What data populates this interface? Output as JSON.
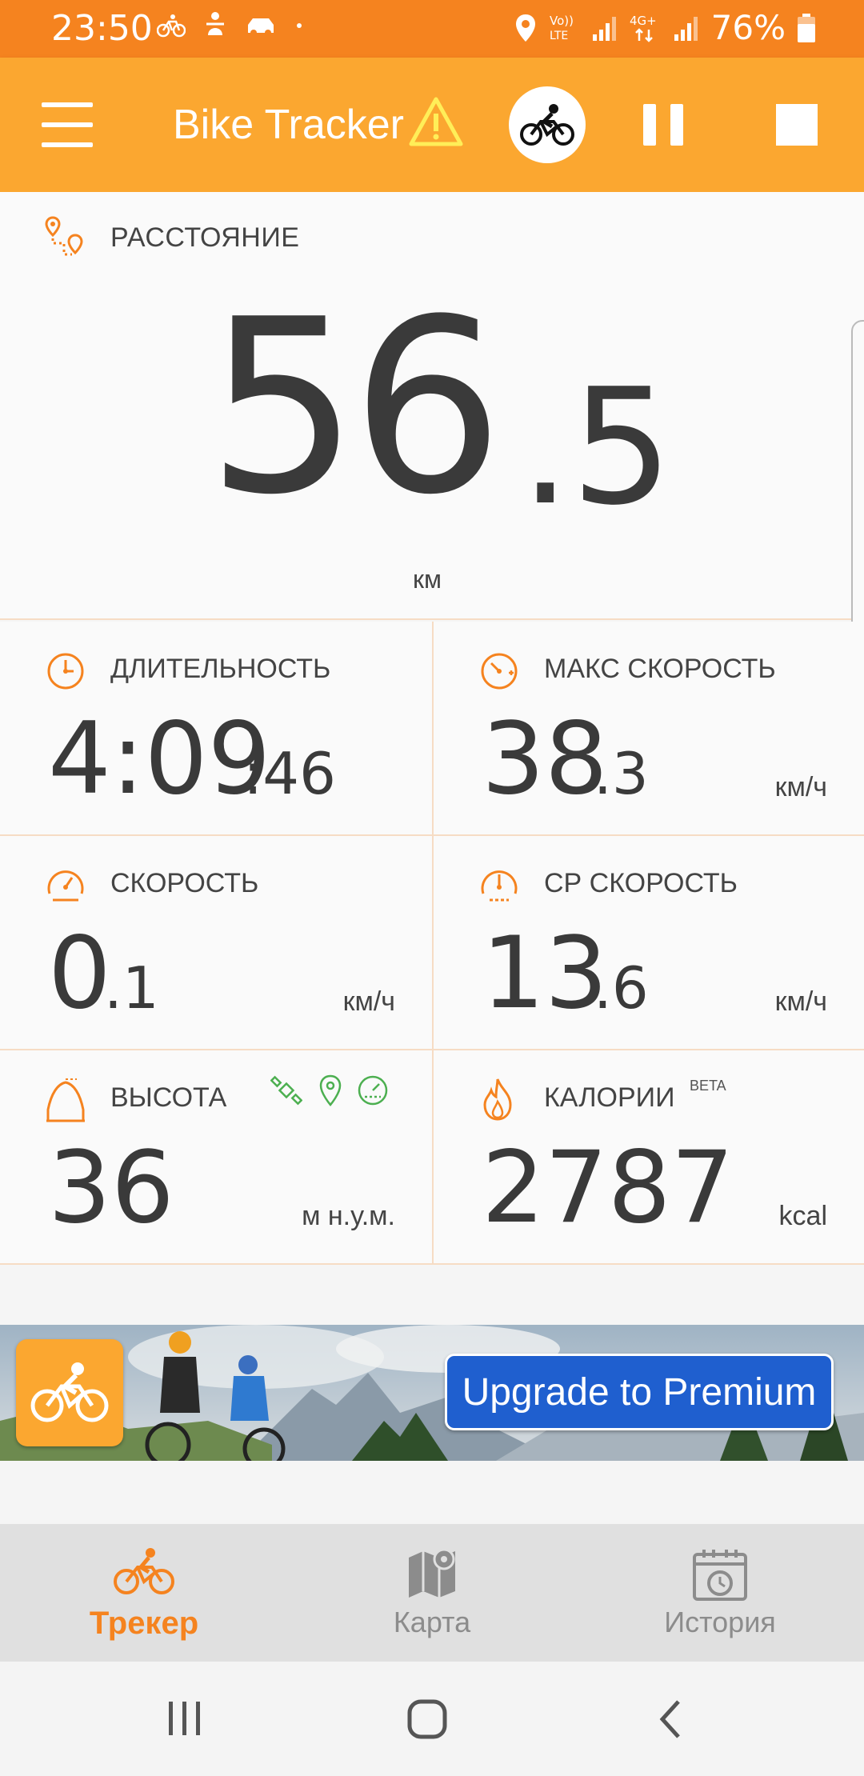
{
  "status_bar": {
    "time": "23:50",
    "battery": "76%",
    "network_label_1": "Vo))\nLTE",
    "network_label_2": "4G+"
  },
  "app_bar": {
    "title": "Bike Tracker",
    "warning_icon": "warning-triangle-icon",
    "activity_icon": "cyclist-icon"
  },
  "distance": {
    "label": "РАССТОЯНИЕ",
    "value_int": "56",
    "value_frac": ".5",
    "unit": "км"
  },
  "stats": {
    "duration": {
      "label": "ДЛИТЕЛЬНОСТЬ",
      "main": "4:09",
      "sub": ":46"
    },
    "max_speed": {
      "label": "МАКС СКОРОСТЬ",
      "main": "38",
      "sub": ".3",
      "unit": "км/ч"
    },
    "speed": {
      "label": "СКОРОСТЬ",
      "main": "0",
      "sub": ".1",
      "unit": "км/ч"
    },
    "avg_speed": {
      "label": "СР СКОРОСТЬ",
      "main": "13",
      "sub": ".6",
      "unit": "км/ч"
    },
    "altitude": {
      "label": "ВЫСОТА",
      "main": "36",
      "unit": "м н.у.м."
    },
    "calories": {
      "label": "КАЛОРИИ",
      "badge": "BETA",
      "main": "2787",
      "unit": "kcal"
    }
  },
  "ad": {
    "button": "Upgrade to Premium"
  },
  "bottom_nav": {
    "items": [
      {
        "label": "Трекер",
        "icon": "cyclist-icon",
        "active": true
      },
      {
        "label": "Карта",
        "icon": "map-icon",
        "active": false
      },
      {
        "label": "История",
        "icon": "calendar-history-icon",
        "active": false
      }
    ]
  },
  "colors": {
    "status_bar": "#f5831f",
    "app_bar": "#fba730",
    "accent": "#f5831f",
    "ad_button": "#1f5fcf",
    "gps_green": "#4caf50"
  }
}
